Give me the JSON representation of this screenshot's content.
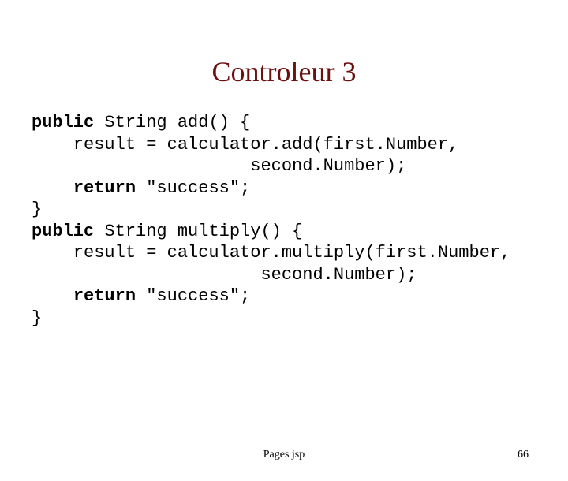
{
  "title": "Controleur 3",
  "code": {
    "l1a": "public",
    "l1b": " String add() {",
    "l2": "    result = calculator.add(first.Number,",
    "l3": "                     second.Number);",
    "l4a": "    ",
    "l4b": "return",
    "l4c": " \"success\";",
    "l5": "}",
    "l6a": "public",
    "l6b": " String multiply() {",
    "l7": "    result = calculator.multiply(first.Number,",
    "l8": "                      second.Number);",
    "l9a": "    ",
    "l9b": "return",
    "l9c": " \"success\";",
    "l10": "}"
  },
  "footer": {
    "center": "Pages jsp",
    "page": "66"
  }
}
